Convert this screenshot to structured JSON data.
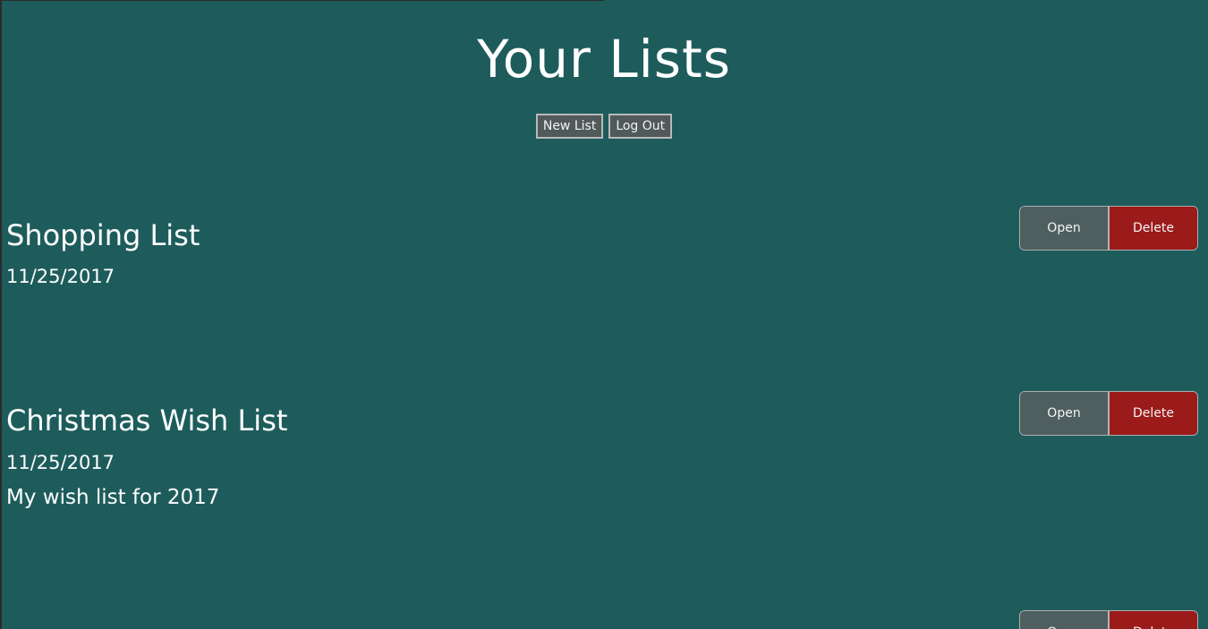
{
  "header": {
    "title": "Your Lists",
    "new_list_label": "New List",
    "log_out_label": "Log Out"
  },
  "lists": [
    {
      "title": "Shopping List",
      "date": "11/25/2017",
      "description": "",
      "open_label": "Open",
      "delete_label": "Delete"
    },
    {
      "title": "Christmas Wish List",
      "date": "11/25/2017",
      "description": "My wish list for 2017",
      "open_label": "Open",
      "delete_label": "Delete"
    },
    {
      "title": "",
      "date": "",
      "description": "",
      "open_label": "Open",
      "delete_label": "Delete"
    }
  ],
  "colors": {
    "background": "#1e5c5c",
    "open_button": "#4f5f5f",
    "delete_button": "#9b1b1b",
    "text": "#ffffff"
  }
}
